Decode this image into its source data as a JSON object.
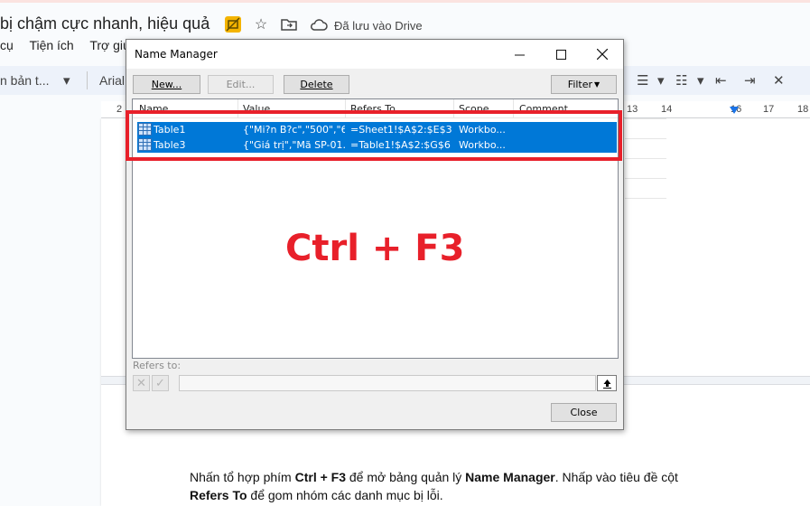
{
  "doc": {
    "title": "bị chậm cực nhanh, hiệu quả",
    "saved_status": "Đã lưu vào Drive",
    "menu": [
      "cụ",
      "Tiện ích",
      "Trợ giú"
    ],
    "toolbar": {
      "style_select": "n bản t...",
      "font_select": "Arial"
    },
    "ruler_numbers": [
      "2",
      "13",
      "14",
      "16",
      "17",
      "18"
    ],
    "caption": {
      "p1": "Nhấn tổ hợp phím ",
      "b1": "Ctrl + F3",
      "p2": " để mở bảng quản lý ",
      "b2": "Name Manager",
      "p3": ". Nhấp vào tiêu đề cột ",
      "b3": "Refers To",
      "p4": " để gom nhóm các danh mục bị lỗi."
    }
  },
  "dialog": {
    "title": "Name Manager",
    "buttons": {
      "new": "New...",
      "edit": "Edit...",
      "delete": "Delete",
      "filter": "Filter",
      "close": "Close"
    },
    "columns": [
      "Name",
      "Value",
      "Refers To",
      "Scope",
      "Comment"
    ],
    "rows": [
      {
        "name": "Table1",
        "value": "{\"Mi?n B?c\",\"500\",\"6...",
        "refers_to": "=Sheet1!$A$2:$E$3",
        "scope": "Workbo..."
      },
      {
        "name": "Table3",
        "value": "{\"Giá trị\",\"Mã SP-01...",
        "refers_to": "=Table1!$A$2:$G$6",
        "scope": "Workbo..."
      }
    ],
    "refers_to_label": "Refers to:",
    "refers_to_value": ""
  },
  "annotation": {
    "shortcut_text": "Ctrl + F3",
    "color": "#e8202a"
  },
  "colors": {
    "selection": "#0078d7",
    "toolbar_bg": "#edf2fa"
  }
}
